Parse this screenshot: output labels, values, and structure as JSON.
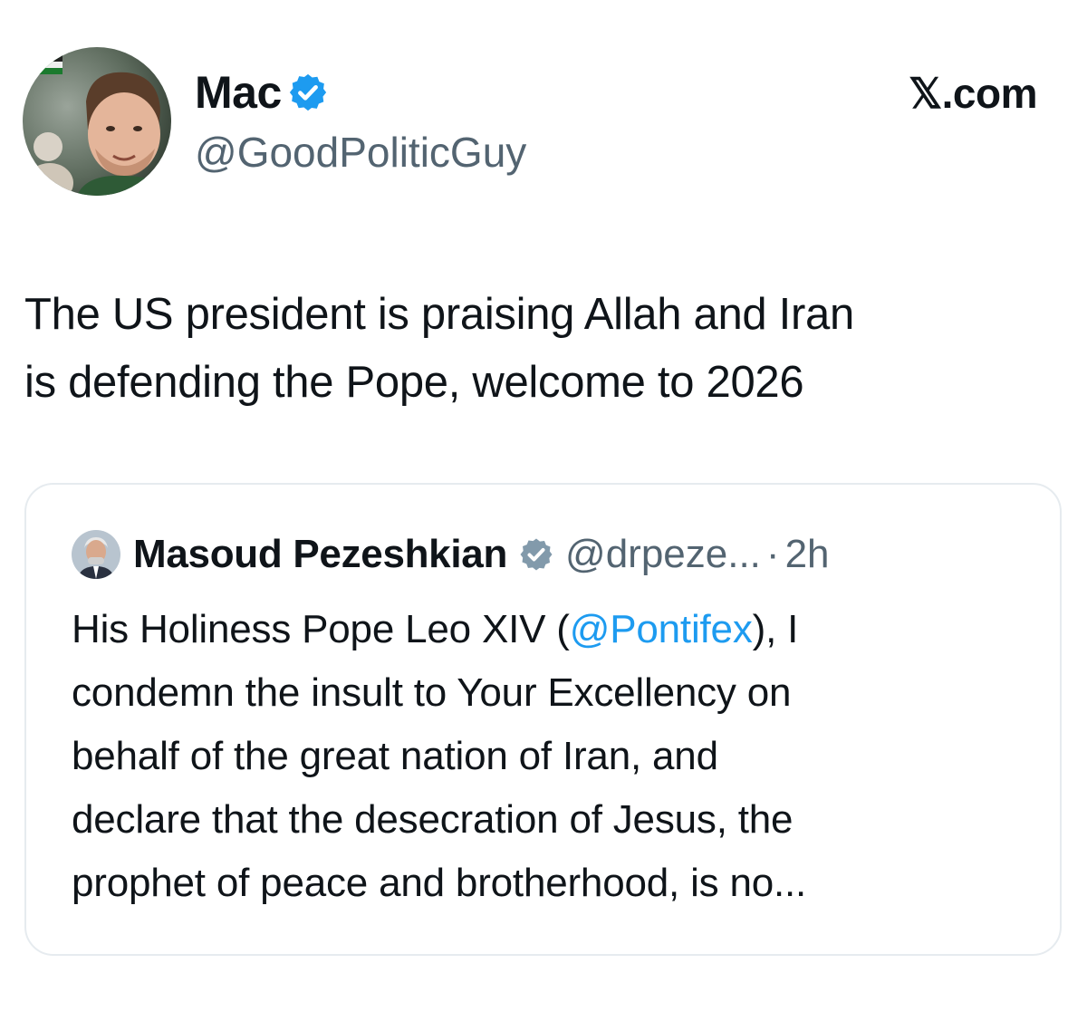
{
  "author": {
    "display_name": "Mac",
    "handle": "@GoodPoliticGuy"
  },
  "brand": "𝕏.com",
  "tweet": {
    "lines": [
      "The US president is praising Allah and Iran",
      "is defending the Pope, welcome to 2026"
    ]
  },
  "quoted_tweet": {
    "display_name": "Masoud Pezeshkian",
    "handle": "@drpeze...",
    "separator": "·",
    "time": "2h",
    "line1_prefix": "His Holiness Pope Leo XIV (",
    "line1_mention": "@Pontifex",
    "line1_suffix": "), I",
    "lines": [
      "condemn the insult to Your Excellency on",
      "behalf of the great nation of Iran, and",
      "declare that the desecration of Jesus, the",
      "prophet of peace and brotherhood, is no..."
    ]
  },
  "colors": {
    "verified_blue": "#1d9bf0",
    "verified_gray": "#829aab",
    "mention": "#1d9bf0",
    "secondary_text": "#536471",
    "card_border": "#e6ebef"
  },
  "icons": {
    "verified": "verified-badge-icon",
    "government_verified": "gray-verified-badge-icon"
  }
}
